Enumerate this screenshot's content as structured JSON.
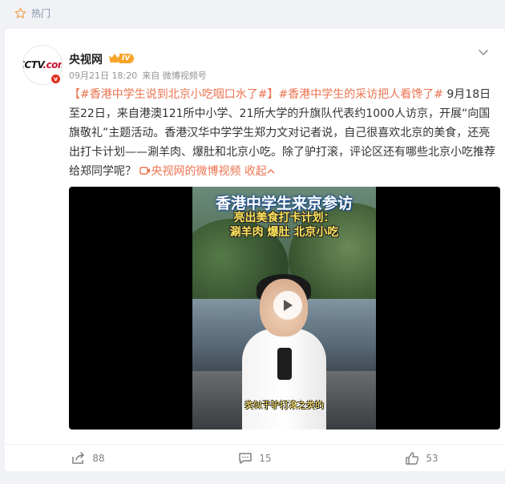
{
  "hot_tag": {
    "label": "热门"
  },
  "post": {
    "username": "央视网",
    "level": "IV",
    "time": "09月21日 18:20",
    "source": "来自 微博视频号",
    "content": {
      "link1": "【#香港中学生说到北京小吃咽口水了#】",
      "link2": "#香港中学生的采访把人看馋了#",
      "body": " 9月18日至22日，来自港澳121所中小学、21所大学的升旗队代表约1000人访京，开展“向国旗敬礼”主题活动。香港汉华中学学生郑力文对记者说，自己很喜欢北京的美食，还亮出打卡计划——涮羊肉、爆肚和北京小吃。除了驴打滚，评论区还有哪些北京小吃推荐给郑同学呢？",
      "video_link": "央视网的微博视频",
      "collapse": "收起"
    },
    "video": {
      "title": "香港中学生来京参访",
      "subtitle_line1": "亮出美食打卡计划：",
      "subtitle_line2": "涮羊肉 爆肚 北京小吃",
      "caption": "类似于驴打滚之类的"
    },
    "actions": {
      "share_count": "88",
      "comment_count": "15",
      "like_count": "53"
    }
  },
  "colors": {
    "link": "#eb7350",
    "badge": "#f7a42a",
    "vbadge": "#e0301e"
  }
}
